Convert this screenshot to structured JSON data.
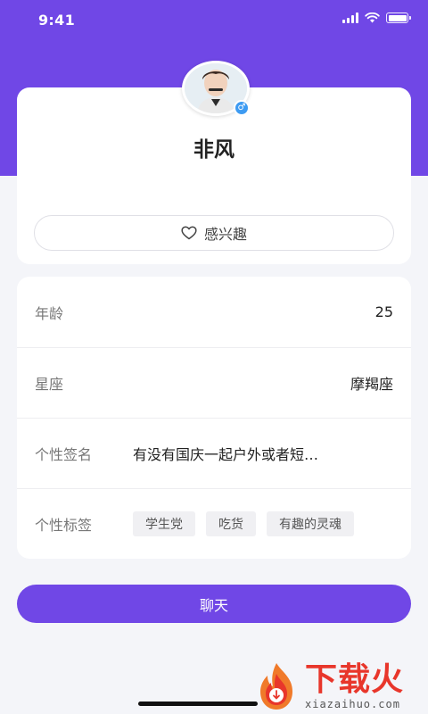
{
  "status_bar": {
    "time": "9:41"
  },
  "profile": {
    "nickname": "非风",
    "gender_symbol": "♂",
    "interest_button_label": "感兴趣"
  },
  "info": {
    "rows": [
      {
        "key": "年龄",
        "value": "25"
      },
      {
        "key": "星座",
        "value": "摩羯座"
      },
      {
        "key": "个性签名",
        "value": "有没有国庆一起户外或者短…"
      },
      {
        "key": "个性标签"
      }
    ],
    "tags": [
      "学生党",
      "吃货",
      "有趣的灵魂"
    ]
  },
  "chat_button_label": "聊天",
  "watermark": {
    "main": "下载火",
    "sub": "xiazaihuo.com"
  },
  "colors": {
    "accent": "#7047e6",
    "gender_badge": "#3d9bf2",
    "watermark": "#e8362b"
  }
}
